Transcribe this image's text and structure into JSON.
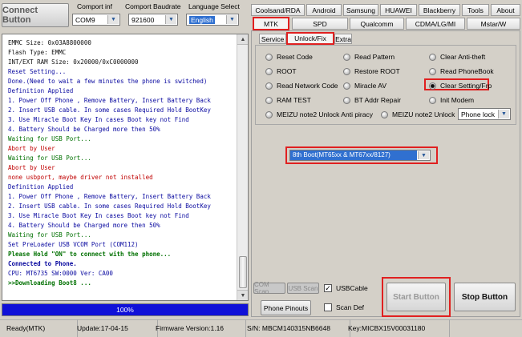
{
  "top": {
    "connect_button": "Connect Button",
    "comport_label": "Comport inf",
    "comport_value": "COM9",
    "baud_label": "Comport Baudrate",
    "baud_value": "921600",
    "lang_label": "Language Select",
    "lang_value": "English"
  },
  "log_lines": [
    {
      "text": "EMMC Size: 0x03A8800000",
      "color": "black",
      "bold": false
    },
    {
      "text": "Flash Type: EMMC",
      "color": "black",
      "bold": false
    },
    {
      "text": "INT/EXT RAM  Size: 0x20000/0xC0000000",
      "color": "black",
      "bold": false
    },
    {
      "text": "Reset Setting...",
      "color": "blue",
      "bold": false
    },
    {
      "text": "Done.(Need to wait a few minutes the phone is switched)",
      "color": "blue",
      "bold": false
    },
    {
      "text": "Definition Applied",
      "color": "blue",
      "bold": false
    },
    {
      "text": "1. Power Off Phone , Remove Battery, Insert Battery Back",
      "color": "blue",
      "bold": false
    },
    {
      "text": "2. Insert USB cable. In some cases Required Hold BootKey",
      "color": "blue",
      "bold": false
    },
    {
      "text": "3. Use Miracle Boot Key In cases Boot key not Find",
      "color": "blue",
      "bold": false
    },
    {
      "text": "4. Battery Should be Charged more then 50%",
      "color": "blue",
      "bold": false
    },
    {
      "text": "Waiting for USB Port...",
      "color": "green",
      "bold": false
    },
    {
      "text": "Abort by User",
      "color": "red",
      "bold": false
    },
    {
      "text": "Waiting for USB Port...",
      "color": "green",
      "bold": false
    },
    {
      "text": "Abort by User",
      "color": "red",
      "bold": false
    },
    {
      "text": "none usbport, maybe driver not installed",
      "color": "red",
      "bold": false
    },
    {
      "text": "Definition Applied",
      "color": "blue",
      "bold": false
    },
    {
      "text": "1. Power Off Phone , Remove Battery, Insert Battery Back",
      "color": "blue",
      "bold": false
    },
    {
      "text": "2. Insert USB cable. In some cases Required Hold BootKey",
      "color": "blue",
      "bold": false
    },
    {
      "text": "3. Use Miracle Boot Key In cases Boot key not Find",
      "color": "blue",
      "bold": false
    },
    {
      "text": "4. Battery Should be Charged more then 50%",
      "color": "blue",
      "bold": false
    },
    {
      "text": "Waiting for USB Port...",
      "color": "green",
      "bold": false
    },
    {
      "text": "Set PreLoader USB VCOM Port (COM112)",
      "color": "blue",
      "bold": false
    },
    {
      "text": " Please Hold \"ON\" to connect with the phone...",
      "color": "green",
      "bold": true
    },
    {
      "text": " Connected to Phone.",
      "color": "blue",
      "bold": true
    },
    {
      "text": "CPU: MT6735 SW:0000 Ver: CA00",
      "color": "blue",
      "bold": false
    },
    {
      "text": ">>Downloading Boot8 ...",
      "color": "green",
      "bold": true
    }
  ],
  "progress": {
    "text": "100%",
    "value": 100
  },
  "tabs_row1": [
    "Coolsand/RDA",
    "Android",
    "Samsung",
    "HUAWEI",
    "Blackberry",
    "Tools",
    "About"
  ],
  "tabs_row2": [
    "MTK",
    "SPD",
    "Qualcomm",
    "CDMA/LG/MI",
    "Mstar/W"
  ],
  "subtabs": [
    "Service",
    "Unlock/Fix",
    "Extra"
  ],
  "options": {
    "reset_code": "Reset Code",
    "read_pattern": "Read Pattern",
    "clear_anti_theft": "Clear Anti-theft",
    "root": "ROOT",
    "restore_root": "Restore ROOT",
    "read_phonebook": "Read PhoneBook",
    "read_network_code": "Read Network Code",
    "miracle_av": "Miracle AV",
    "clear_setting": "Clear Setting/Frp",
    "ram_test": "RAM TEST",
    "bt_addr_repair": "BT Addr Repair",
    "init_modem": "Init Modem",
    "meizu_anti_piracy": "MEIZU note2  Unlock Anti piracy",
    "meizu_unlock": "MEIZU note2  Unlock",
    "phone_lock": "Phone lock"
  },
  "boot_select": "8th Boot(MT65xx & MT67xx/8127)",
  "bottom": {
    "com_scan": "COM Scan",
    "usb_scan": "USB Scan",
    "usbcable": "USBCable",
    "phone_pinouts": "Phone Pinouts",
    "scan_def": "Scan Def",
    "start_button": "Start Button",
    "stop_button": "Stop Button"
  },
  "status": {
    "ready": "Ready(MTK)",
    "update": "Update:17-04-15",
    "firmware": "Firmware Version:1.16",
    "sn": "S/N: MBCM140315NB6648",
    "key": "Key:MICBX15V00031180"
  },
  "colors": {
    "accent_red": "#e02020",
    "progress_blue": "#1010d8",
    "selection_blue": "#3070d0"
  }
}
